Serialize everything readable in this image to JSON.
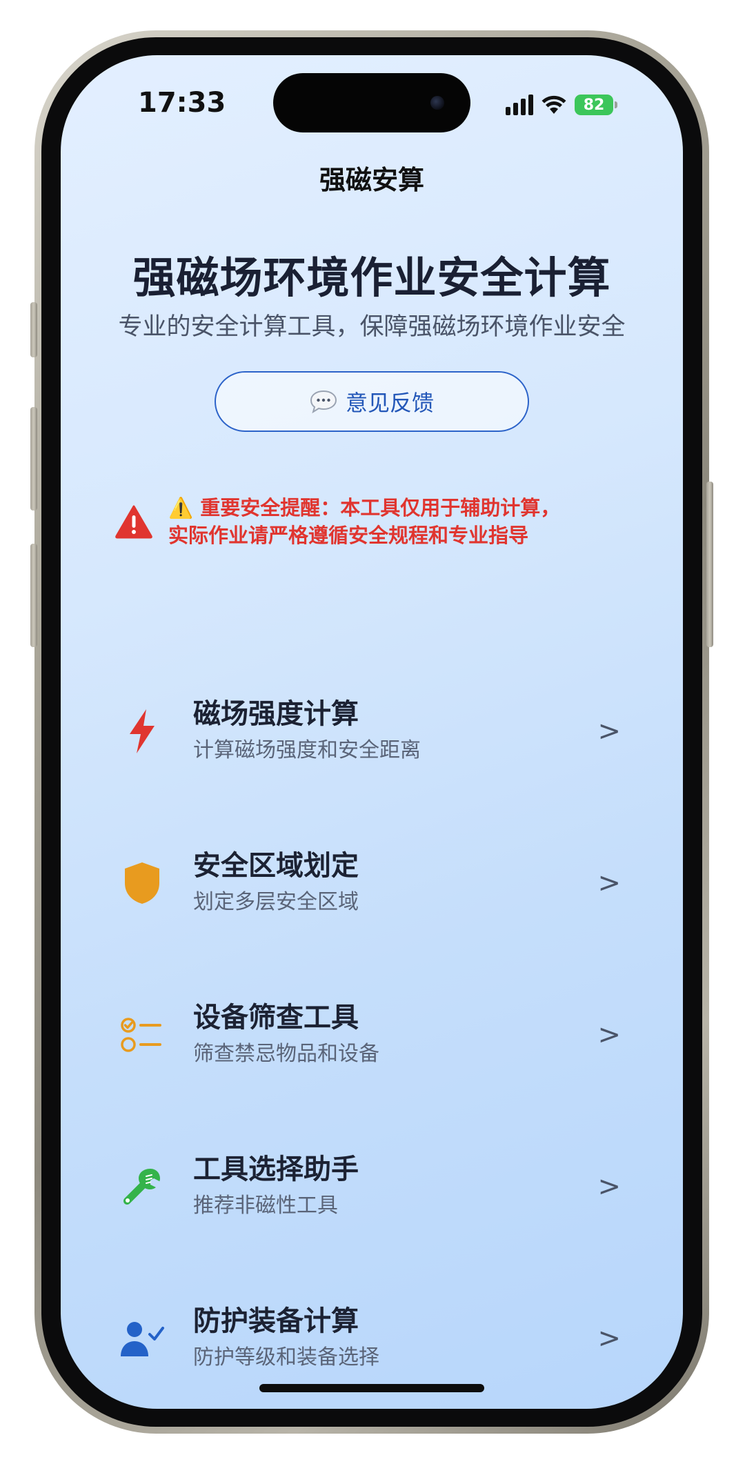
{
  "status_bar": {
    "time": "17:33",
    "battery": "82"
  },
  "nav": {
    "title": "强磁安算"
  },
  "hero": {
    "title": "强磁场环境作业安全计算",
    "subtitle": "专业的安全计算工具，保障强磁场环境作业安全"
  },
  "feedback": {
    "label": "意见反馈"
  },
  "warning": {
    "line1": "⚠️ 重要安全提醒：本工具仅用于辅助计算，",
    "line2": "实际作业请严格遵循安全规程和专业指导"
  },
  "menu": {
    "items": [
      {
        "title": "磁场强度计算",
        "desc": "计算磁场强度和安全距离",
        "icon": "lightning-icon",
        "color": "#e0352f"
      },
      {
        "title": "安全区域划定",
        "desc": "划定多层安全区域",
        "icon": "shield-icon",
        "color": "#e89b1f"
      },
      {
        "title": "设备筛查工具",
        "desc": "筛查禁忌物品和设备",
        "icon": "checklist-icon",
        "color": "#e89b1f"
      },
      {
        "title": "工具选择助手",
        "desc": "推荐非磁性工具",
        "icon": "wrench-icon",
        "color": "#34b34a"
      },
      {
        "title": "防护装备计算",
        "desc": "防护等级和装备选择",
        "icon": "user-check-icon",
        "color": "#2462c8"
      }
    ],
    "chevron": ">"
  }
}
